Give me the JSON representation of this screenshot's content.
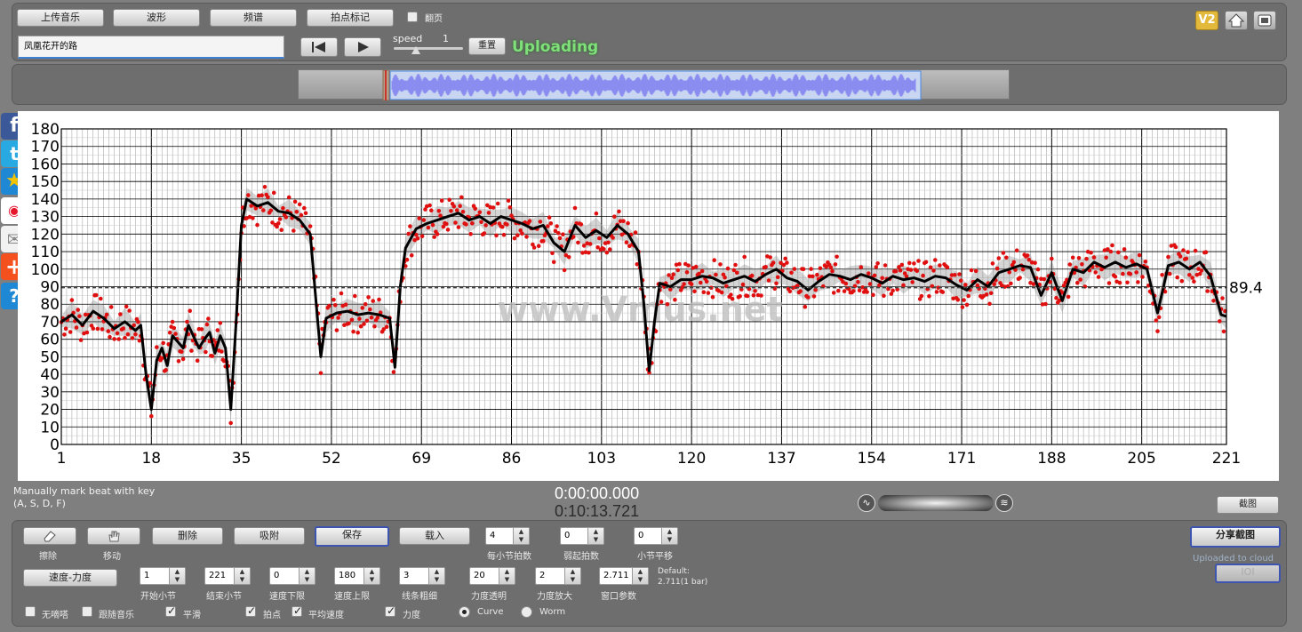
{
  "toolbar": {
    "upload_music": "上传音乐",
    "waveform": "波形",
    "spectrum": "频谱",
    "beat_mark": "拍点标记",
    "flip_page": "翻页"
  },
  "track": {
    "name": "凤凰花开的路",
    "speed_label": "speed",
    "speed_value": "1",
    "reset_label": "重置",
    "status": "Uploading"
  },
  "top_right": {
    "version_badge": "V2"
  },
  "chart_data": {
    "type": "scatter",
    "xticks": [
      "1",
      "18",
      "35",
      "52",
      "69",
      "86",
      "103",
      "120",
      "137",
      "154",
      "171",
      "188",
      "205",
      "221"
    ],
    "yticks": [
      "0",
      "10",
      "20",
      "30",
      "40",
      "50",
      "60",
      "70",
      "80",
      "90",
      "100",
      "110",
      "120",
      "130",
      "140",
      "150",
      "160",
      "170",
      "180"
    ],
    "xlim": [
      1,
      221
    ],
    "ylim": [
      0,
      180
    ],
    "average": 89.4,
    "average_label": "89.4",
    "watermark": "www.Vmus.net",
    "grid": true,
    "series": [
      {
        "values": [
          [
            1,
            70
          ],
          [
            3,
            74
          ],
          [
            5,
            68
          ],
          [
            7,
            76
          ],
          [
            9,
            72
          ],
          [
            11,
            66
          ],
          [
            13,
            70
          ],
          [
            15,
            65
          ],
          [
            16,
            68
          ],
          [
            17,
            40
          ],
          [
            18,
            20
          ],
          [
            19,
            48
          ],
          [
            20,
            55
          ],
          [
            21,
            45
          ],
          [
            22,
            62
          ],
          [
            24,
            55
          ],
          [
            25,
            68
          ],
          [
            27,
            55
          ],
          [
            28,
            60
          ],
          [
            29,
            64
          ],
          [
            30,
            52
          ],
          [
            31,
            62
          ],
          [
            32,
            55
          ],
          [
            33,
            20
          ],
          [
            34,
            70
          ],
          [
            35,
            125
          ],
          [
            36,
            140
          ],
          [
            38,
            136
          ],
          [
            40,
            138
          ],
          [
            42,
            133
          ],
          [
            44,
            132
          ],
          [
            46,
            128
          ],
          [
            48,
            120
          ],
          [
            49,
            85
          ],
          [
            50,
            50
          ],
          [
            51,
            72
          ],
          [
            53,
            75
          ],
          [
            55,
            76
          ],
          [
            57,
            74
          ],
          [
            59,
            75
          ],
          [
            61,
            74
          ],
          [
            63,
            72
          ],
          [
            64,
            44
          ],
          [
            65,
            90
          ],
          [
            66,
            112
          ],
          [
            68,
            123
          ],
          [
            70,
            126
          ],
          [
            72,
            128
          ],
          [
            74,
            130
          ],
          [
            76,
            132
          ],
          [
            78,
            128
          ],
          [
            80,
            130
          ],
          [
            82,
            126
          ],
          [
            84,
            130
          ],
          [
            86,
            128
          ],
          [
            88,
            126
          ],
          [
            90,
            123
          ],
          [
            92,
            125
          ],
          [
            94,
            115
          ],
          [
            96,
            110
          ],
          [
            98,
            125
          ],
          [
            100,
            118
          ],
          [
            102,
            122
          ],
          [
            104,
            118
          ],
          [
            106,
            125
          ],
          [
            108,
            120
          ],
          [
            110,
            110
          ],
          [
            111,
            80
          ],
          [
            112,
            42
          ],
          [
            113,
            70
          ],
          [
            114,
            92
          ],
          [
            116,
            90
          ],
          [
            118,
            94
          ],
          [
            120,
            94
          ],
          [
            122,
            96
          ],
          [
            124,
            95
          ],
          [
            126,
            92
          ],
          [
            128,
            94
          ],
          [
            130,
            96
          ],
          [
            132,
            93
          ],
          [
            134,
            97
          ],
          [
            136,
            100
          ],
          [
            138,
            95
          ],
          [
            140,
            93
          ],
          [
            142,
            88
          ],
          [
            144,
            93
          ],
          [
            146,
            97
          ],
          [
            148,
            96
          ],
          [
            150,
            94
          ],
          [
            152,
            97
          ],
          [
            154,
            95
          ],
          [
            156,
            92
          ],
          [
            158,
            96
          ],
          [
            160,
            94
          ],
          [
            162,
            95
          ],
          [
            164,
            93
          ],
          [
            166,
            96
          ],
          [
            168,
            95
          ],
          [
            170,
            91
          ],
          [
            172,
            88
          ],
          [
            174,
            94
          ],
          [
            176,
            90
          ],
          [
            178,
            98
          ],
          [
            180,
            100
          ],
          [
            182,
            102
          ],
          [
            184,
            101
          ],
          [
            186,
            85
          ],
          [
            188,
            98
          ],
          [
            190,
            82
          ],
          [
            192,
            100
          ],
          [
            194,
            98
          ],
          [
            196,
            104
          ],
          [
            198,
            101
          ],
          [
            200,
            104
          ],
          [
            202,
            101
          ],
          [
            204,
            103
          ],
          [
            206,
            100
          ],
          [
            208,
            75
          ],
          [
            210,
            102
          ],
          [
            212,
            104
          ],
          [
            214,
            100
          ],
          [
            216,
            104
          ],
          [
            218,
            96
          ],
          [
            220,
            74
          ],
          [
            221,
            73
          ]
        ]
      }
    ]
  },
  "status": {
    "hint_line1": "Manually mark beat with key",
    "hint_line2": "(A, S, D, F)",
    "time_current": "0:00:00.000",
    "time_total": "0:10:13.721",
    "screenshot_button": "截图"
  },
  "controls": {
    "erase_label": "擦除",
    "move_label": "移动",
    "delete_button": "删除",
    "absorb_button": "吸附",
    "save_button": "保存",
    "load_button": "载入",
    "beats_per_bar_value": "4",
    "beats_per_bar_label": "每小节拍数",
    "weak_beats_value": "0",
    "weak_beats_label": "弱起拍数",
    "bar_shift_value": "0",
    "bar_shift_label": "小节平移",
    "share_button": "分享截图",
    "uploaded_text": "Uploaded to cloud",
    "ioi_button": "IOI",
    "tempo_dynamics_button": "速度-力度",
    "start_bar_value": "1",
    "start_bar_label": "开始小节",
    "end_bar_value": "221",
    "end_bar_label": "结束小节",
    "tempo_min_value": "0",
    "tempo_min_label": "速度下限",
    "tempo_max_value": "180",
    "tempo_max_label": "速度上限",
    "line_width_value": "3",
    "line_width_label": "线条粗细",
    "dyn_opacity_value": "20",
    "dyn_opacity_label": "力度透明",
    "dyn_scale_value": "2",
    "dyn_scale_label": "力度放大",
    "window_value": "2.711",
    "window_label": "窗口参数",
    "default_line1": "Default:",
    "default_line2": "2.711(1 bar)",
    "no_click_label": "无嘀嗒",
    "follow_music_label": "跟随音乐",
    "smooth_label": "平滑",
    "beat_point_label": "拍点",
    "avg_tempo_label": "平均速度",
    "dynamics_label": "力度",
    "curve_label": "Curve",
    "worm_label": "Worm"
  },
  "colors": {
    "accent": "#3d55b0",
    "status_green": "#7fe07a",
    "point_red": "#e01010",
    "waveform": "#8a8cf0"
  }
}
